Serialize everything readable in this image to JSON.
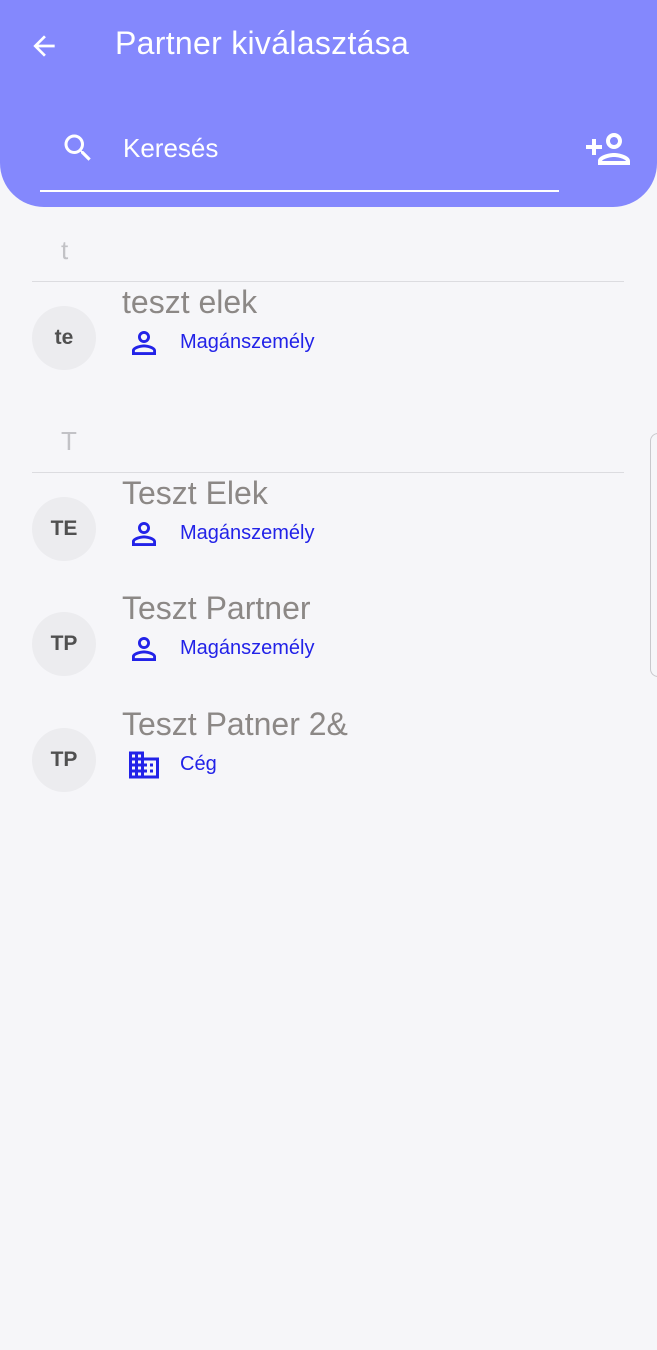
{
  "header": {
    "title": "Partner kiválasztása",
    "back_icon": "arrow-left-icon",
    "add_icon": "person-add-icon",
    "color": "#8488fd"
  },
  "search": {
    "placeholder": "Keresés",
    "value": "",
    "icon": "search-icon"
  },
  "sections": [
    {
      "letter": "t",
      "items": [
        {
          "initials": "te",
          "name": "teszt elek",
          "type": "Magánszemély",
          "type_icon": "person-icon"
        }
      ]
    },
    {
      "letter": "T",
      "items": [
        {
          "initials": "TE",
          "name": "Teszt Elek",
          "type": "Magánszemély",
          "type_icon": "person-icon"
        },
        {
          "initials": "TP",
          "name": "Teszt Partner",
          "type": "Magánszemély",
          "type_icon": "person-icon"
        },
        {
          "initials": "TP",
          "name": "Teszt Patner 2&",
          "type": "Cég",
          "type_icon": "building-icon"
        }
      ]
    }
  ],
  "colors": {
    "accent": "#8488fd",
    "type_label": "#2222e8",
    "background": "#f6f6f9"
  }
}
